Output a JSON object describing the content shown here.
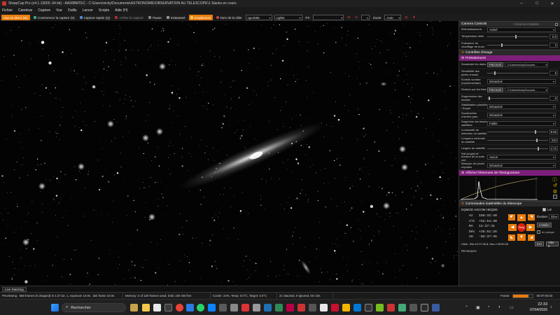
{
  "window": {
    "title": "SharpCap Pro (v4.1.13000, 64 bit) - AA50BMTEC - C:\\Users\\nicky\\Documents\\ASTRONOMIE\\OBSERVATION AU TELESCOPE\\1 Stacks en cours",
    "minimize": "–",
    "maximize": "□",
    "close": "✕"
  },
  "menu": [
    "Fichier",
    "Caméras",
    "Capture",
    "Vue",
    "Outils",
    "Lancer",
    "Scripts",
    "Aide (H)"
  ],
  "toolbar": {
    "live_view": "Vue en direct (W)",
    "start_capture": "Commencer la capture (S)",
    "quick_capture": "Capture rapide (Q)",
    "stop_capture": "Arrêter la capture",
    "pause": "Pause",
    "snapshot": "Instantané",
    "stacking": "Empilement",
    "target_label": "Nom de la cible",
    "target_value": "ngc4565",
    "frame_type": "Lights",
    "fx_label": "FX",
    "zoom_label": "Zoom",
    "zoom_value": "Auto"
  },
  "panel": {
    "camera_controls": "Camera Controls",
    "hide_when_inactive": "Colonnes invitation",
    "cooling_label": "Refroidissement",
    "cooling_value": "Activé",
    "temp_label": "Température cible",
    "temp_value": "0.0",
    "heater_label": "Puissance du chauffage de buée",
    "heater_value": "2",
    "image_controls": "Contrôles d'image",
    "preprocessing": "Prétraitement",
    "darks_label": "Soustraire les darks",
    "browse": "Parcourir",
    "dark_path": "C:\\Users\\nicky\\Docume...",
    "hot_pixel_label": "Sensibilité des pixels chauds",
    "hot_pixel_value": "5",
    "dark_scale_label": "Échelle sombre (expérimentale)",
    "dark_scale_value": "Désactivé",
    "flat_label": "Division par les flats",
    "flat_path": "C:\\Users\\nicky\\Docume...",
    "banding_label": "Suppression des bandes",
    "banding_value": "0",
    "flat_stab_label": "Stabilisation planéité / floque",
    "flat_stab_value": "Désactivé",
    "bg_sub_label": "Soustraction d'arrière-plan",
    "bg_sub_value": "Désactivé",
    "satellite_label": "Supprimer les traces satellites",
    "satellite_value": "Faible",
    "sat_thresh_label": "Luminosité de détection du satellite",
    "sat_thresh_value": "8.60",
    "sat_min_label": "Longueur minimale du satellite",
    "sat_min_value": "234",
    "sat_width_label": "Largeur du satellite",
    "sat_width_value": "4.72",
    "sat_mask_label": "Sat coupés et bordure de la suite vert",
    "sat_mask_value": "Aucun",
    "gain_mask_label": "Masquer les pixels exposés",
    "gain_mask_value": "Désactivé",
    "histogram": "Afficher l'étirement de l'histogramme",
    "mount_controls": "Commandes matérielles du télescope",
    "mount_name": "EQMOD ASCOM HEQ5/6",
    "connect_label": "Lié",
    "az_label": "Az",
    "az_value": "158:32:40",
    "alt_label": "Alt",
    "alt_value": "+52:54:30",
    "ra_label": "RA",
    "ra_value": "12:37:41",
    "dec_label": "Déc",
    "dec_value": "+25:51:26",
    "ah_label": "AH",
    "ah_value": "-02:37:45",
    "track_label": "Évaluer",
    "rate_value": "32x",
    "park_label": "Installer",
    "in_park": "en parque",
    "stop_label": "Stop",
    "goto_prefix": "Cible : RA=12:37:40.8, Dec=+25:50:26",
    "goto_btn": "Env",
    "goto2_btn": "Aller à",
    "notes_label": "Remarques"
  },
  "live_stacking_tab": "Live Stacking",
  "status": {
    "previewing": "Previewing : 568 frames (0 dropped) in 1:27:42, 1, exposure 10.0s , last frame 10.0s",
    "memory": "Memory: 4 of 129 frames used, Disk: 226 GB free",
    "cooler": "Cooler: 24%, Temp: 0.0°C, Target: 0.0°C",
    "stacked": "21 Stacked, 0 Ignored, 5m 10s",
    "frame_label": "Frame:",
    "frame_value": "00:07:00.03",
    "progress_fraction": 0.8
  },
  "taskbar": {
    "search": "Rechercher",
    "time": "22:33",
    "date": "07/04/2026"
  },
  "colors": {
    "accent": "#e87c0c",
    "section": "#7d1f7a"
  }
}
